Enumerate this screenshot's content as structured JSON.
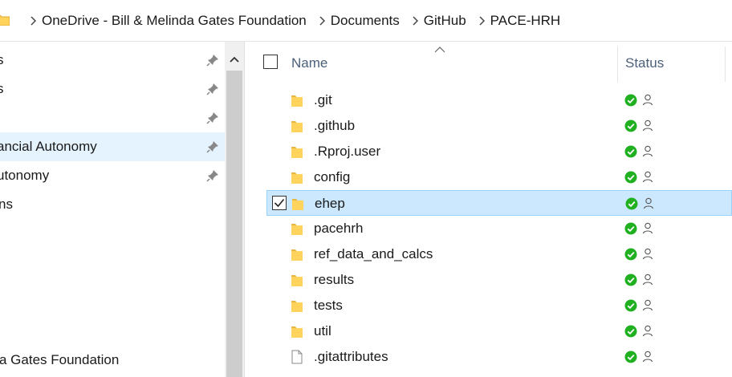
{
  "address_bar": {
    "crumbs": [
      "OneDrive - Bill & Melinda Gates Foundation",
      "Documents",
      "GitHub",
      "PACE-HRH"
    ]
  },
  "nav_pane": {
    "items": [
      {
        "label": "s",
        "pinned": true
      },
      {
        "label": "s",
        "pinned": true
      },
      {
        "label": "",
        "pinned": true
      },
      {
        "label": "ancial Autonomy",
        "pinned": true,
        "selected": true
      },
      {
        "label": "utonomy",
        "pinned": true
      },
      {
        "label": "ns",
        "pinned": false
      },
      {
        "label": "a Gates Foundation",
        "pinned": false
      }
    ]
  },
  "file_list": {
    "columns": {
      "name": "Name",
      "status": "Status"
    },
    "files": [
      {
        "name": ".git",
        "type": "folder"
      },
      {
        "name": ".github",
        "type": "folder"
      },
      {
        "name": ".Rproj.user",
        "type": "folder"
      },
      {
        "name": "config",
        "type": "folder"
      },
      {
        "name": "ehep",
        "type": "folder",
        "selected": true
      },
      {
        "name": "pacehrh",
        "type": "folder"
      },
      {
        "name": "ref_data_and_calcs",
        "type": "folder"
      },
      {
        "name": "results",
        "type": "folder"
      },
      {
        "name": "tests",
        "type": "folder"
      },
      {
        "name": "util",
        "type": "folder"
      },
      {
        "name": ".gitattributes",
        "type": "file"
      }
    ]
  },
  "colors": {
    "selection": "#cce8ff",
    "selection_border": "#99d1ff",
    "nav_selection": "#e5f3ff",
    "sync_ok": "#20b020",
    "folder": "#ffd35c",
    "header_text": "#4c607a"
  }
}
